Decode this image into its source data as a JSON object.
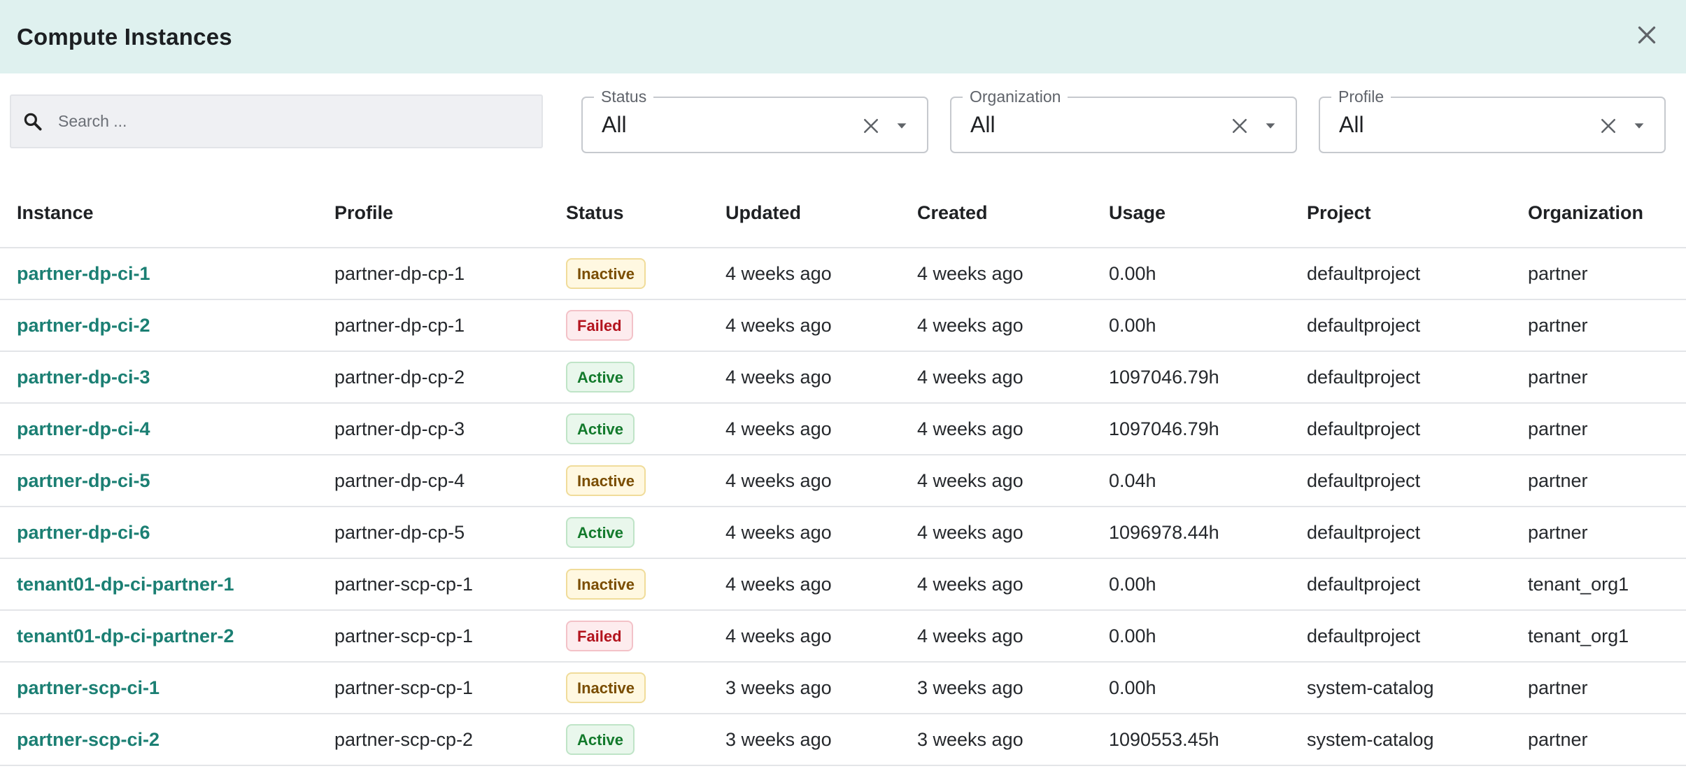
{
  "dialog": {
    "title": "Compute Instances",
    "close_icon": "close-icon",
    "header_bg": "#dff1ef"
  },
  "search": {
    "placeholder": "Search ...",
    "value": "",
    "icon": "search-icon"
  },
  "filters": [
    {
      "label": "Status",
      "value": "All"
    },
    {
      "label": "Organization",
      "value": "All"
    },
    {
      "label": "Profile",
      "value": "All"
    }
  ],
  "table": {
    "columns": [
      "Instance",
      "Profile",
      "Status",
      "Updated",
      "Created",
      "Usage",
      "Project",
      "Organization"
    ],
    "rows": [
      {
        "instance": "partner-dp-ci-1",
        "profile": "partner-dp-cp-1",
        "status": "Inactive",
        "updated": "4 weeks ago",
        "created": "4 weeks ago",
        "usage": "0.00h",
        "project": "defaultproject",
        "organization": "partner"
      },
      {
        "instance": "partner-dp-ci-2",
        "profile": "partner-dp-cp-1",
        "status": "Failed",
        "updated": "4 weeks ago",
        "created": "4 weeks ago",
        "usage": "0.00h",
        "project": "defaultproject",
        "organization": "partner"
      },
      {
        "instance": "partner-dp-ci-3",
        "profile": "partner-dp-cp-2",
        "status": "Active",
        "updated": "4 weeks ago",
        "created": "4 weeks ago",
        "usage": "1097046.79h",
        "project": "defaultproject",
        "organization": "partner"
      },
      {
        "instance": "partner-dp-ci-4",
        "profile": "partner-dp-cp-3",
        "status": "Active",
        "updated": "4 weeks ago",
        "created": "4 weeks ago",
        "usage": "1097046.79h",
        "project": "defaultproject",
        "organization": "partner"
      },
      {
        "instance": "partner-dp-ci-5",
        "profile": "partner-dp-cp-4",
        "status": "Inactive",
        "updated": "4 weeks ago",
        "created": "4 weeks ago",
        "usage": "0.04h",
        "project": "defaultproject",
        "organization": "partner"
      },
      {
        "instance": "partner-dp-ci-6",
        "profile": "partner-dp-cp-5",
        "status": "Active",
        "updated": "4 weeks ago",
        "created": "4 weeks ago",
        "usage": "1096978.44h",
        "project": "defaultproject",
        "organization": "partner"
      },
      {
        "instance": "tenant01-dp-ci-partner-1",
        "profile": "partner-scp-cp-1",
        "status": "Inactive",
        "updated": "4 weeks ago",
        "created": "4 weeks ago",
        "usage": "0.00h",
        "project": "defaultproject",
        "organization": "tenant_org1"
      },
      {
        "instance": "tenant01-dp-ci-partner-2",
        "profile": "partner-scp-cp-1",
        "status": "Failed",
        "updated": "4 weeks ago",
        "created": "4 weeks ago",
        "usage": "0.00h",
        "project": "defaultproject",
        "organization": "tenant_org1"
      },
      {
        "instance": "partner-scp-ci-1",
        "profile": "partner-scp-cp-1",
        "status": "Inactive",
        "updated": "3 weeks ago",
        "created": "3 weeks ago",
        "usage": "0.00h",
        "project": "system-catalog",
        "organization": "partner"
      },
      {
        "instance": "partner-scp-ci-2",
        "profile": "partner-scp-cp-2",
        "status": "Active",
        "updated": "3 weeks ago",
        "created": "3 weeks ago",
        "usage": "1090553.45h",
        "project": "system-catalog",
        "organization": "partner"
      }
    ]
  },
  "colors": {
    "link": "#1b7f73",
    "status_inactive": "#7a4d00",
    "status_failed": "#b3141e",
    "status_active": "#137a2c"
  }
}
